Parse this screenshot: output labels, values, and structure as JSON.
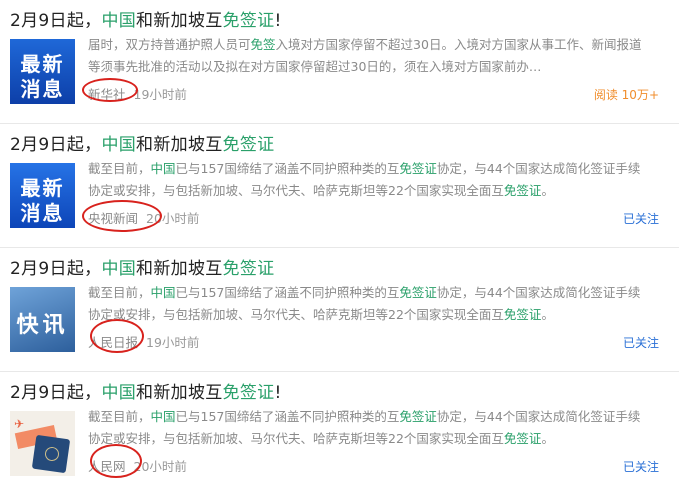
{
  "items": [
    {
      "title_a": "2月9日起，",
      "title_hl1": "中国",
      "title_b": "和新加坡互",
      "title_hl2": "免签证",
      "title_c": "!",
      "thumb_line1": "最新",
      "thumb_line2": "消息",
      "summary_a": "届时，双方持普通护照人员可",
      "summary_hl1": "免签",
      "summary_b": "入境对方国家停留不超过30日。入境对方国家从事工作、新闻报道等须事先批准的活动以及拟在对方国家停留超过30日的，须在入境对方国家前办…",
      "source": "新华社",
      "time": "19小时前",
      "right_link": "阅读 10万+"
    },
    {
      "title_a": "2月9日起，",
      "title_hl1": "中国",
      "title_b": "和新加坡互",
      "title_hl2": "免签证",
      "title_c": "",
      "thumb_line1": "最新",
      "thumb_line2": "消息",
      "summary_a": "截至目前，",
      "summary_hl1": "中国",
      "summary_b": "已与157国缔结了涵盖不同护照种类的互",
      "summary_hl2": "免签证",
      "summary_c": "协定，与44个国家达成简化签证手续协定或安排，与包括新加坡、马尔代夫、哈萨克斯坦等22个国家实现全面互",
      "summary_hl3": "免签证",
      "summary_d": "。",
      "source": "央视新闻",
      "time": "20小时前",
      "right_link": "已关注"
    },
    {
      "title_a": "2月9日起，",
      "title_hl1": "中国",
      "title_b": "和新加坡互",
      "title_hl2": "免签证",
      "title_c": "",
      "thumb_line1": "快讯",
      "summary_a": "截至目前，",
      "summary_hl1": "中国",
      "summary_b": "已与157国缔结了涵盖不同护照种类的互",
      "summary_hl2": "免签证",
      "summary_c": "协定，与44个国家达成简化签证手续协定或安排，与包括新加坡、马尔代夫、哈萨克斯坦等22个国家实现全面互",
      "summary_hl3": "免签证",
      "summary_d": "。",
      "source": "人民日报",
      "time": "19小时前",
      "right_link": "已关注"
    },
    {
      "title_a": "2月9日起，",
      "title_hl1": "中国",
      "title_b": "和新加坡互",
      "title_hl2": "免签证",
      "title_c": "!",
      "summary_a": "截至目前，",
      "summary_hl1": "中国",
      "summary_b": "已与157国缔结了涵盖不同护照种类的互",
      "summary_hl2": "免签证",
      "summary_c": "协定，与44个国家达成简化签证手续协定或安排，与包括新加坡、马尔代夫、哈萨克斯坦等22个国家实现全面互",
      "summary_hl3": "免签证",
      "summary_d": "。",
      "source": "人民网",
      "time": "20小时前",
      "right_link": "已关注"
    }
  ],
  "colors": {
    "highlight": "#2aa06a",
    "link": "#2a70d6",
    "read": "#f08d2c",
    "annotation": "#d8221d"
  }
}
